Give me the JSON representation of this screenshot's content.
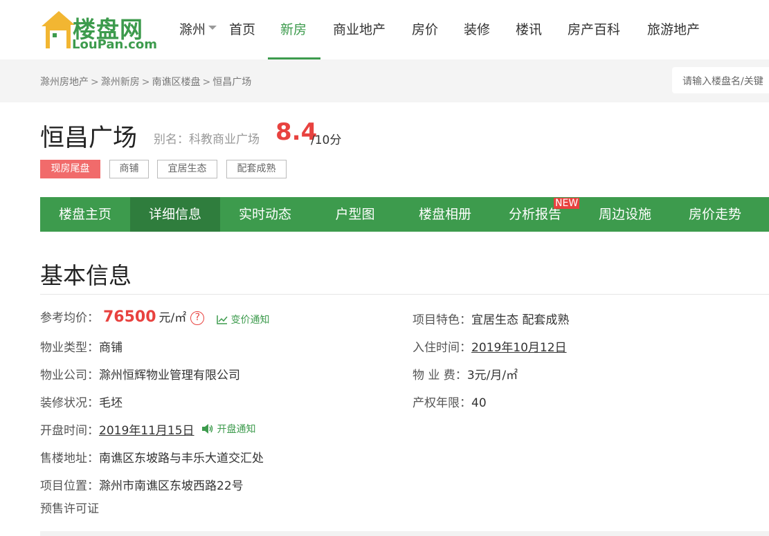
{
  "logo": {
    "cn": "楼盘网",
    "en": "LouPan.com"
  },
  "header": {
    "city": "滁州",
    "nav": [
      "首页",
      "新房",
      "商业地产",
      "房价",
      "装修",
      "楼讯",
      "房产百科",
      "旅游地产"
    ],
    "active_nav": "新房"
  },
  "breadcrumb": {
    "items": [
      "滁州房地产",
      "滁州新房",
      "南谯区楼盘",
      "恒昌广场"
    ],
    "separator": ">"
  },
  "search": {
    "placeholder": "请输入楼盘名/关键"
  },
  "project": {
    "name": "恒昌广场",
    "alias_label": "别名：",
    "alias": "科教商业广场",
    "score": "8.4",
    "score_unit": "/10分",
    "tags": [
      "现房尾盘",
      "商铺",
      "宜居生态",
      "配套成熟"
    ]
  },
  "tabs": {
    "items": [
      "楼盘主页",
      "详细信息",
      "实时动态",
      "户型图",
      "楼盘相册",
      "分析报告",
      "周边设施",
      "房价走势"
    ],
    "active": "详细信息",
    "new_badge": "NEW"
  },
  "basic_info": {
    "title": "基本信息",
    "price_label": "参考均价：",
    "price_value": "76500",
    "price_unit": "元/㎡",
    "help_icon": "?",
    "price_notify": "变价通知",
    "feature_label": "项目特色：",
    "feature_value": "宜居生态 配套成熟",
    "type_label": "物业类型：",
    "type_value": "商铺",
    "movein_label": "入住时间：",
    "movein_value": "2019年10月12日",
    "company_label": "物业公司：",
    "company_value": "滁州恒辉物业管理有限公司",
    "fee_label": "物 业 费：",
    "fee_value": "3元/月/㎡",
    "decor_label": "装修状况：",
    "decor_value": "毛坯",
    "term_label": "产权年限：",
    "term_value": "40",
    "open_label": "开盘时间：",
    "open_value": "2019年11月15日",
    "open_notify": "开盘通知",
    "sales_label": "售楼地址：",
    "sales_value": "南谯区东坡路与丰乐大道交汇处",
    "location_label": "项目位置：",
    "location_value": "滁州市南谯区东坡西路22号",
    "permit_label": "预售许可证"
  },
  "colors": {
    "brand_green": "#3d9b4d",
    "dark_green": "#2f7d3d",
    "accent_red": "#e8423f",
    "tag_red": "#f16b6b"
  }
}
